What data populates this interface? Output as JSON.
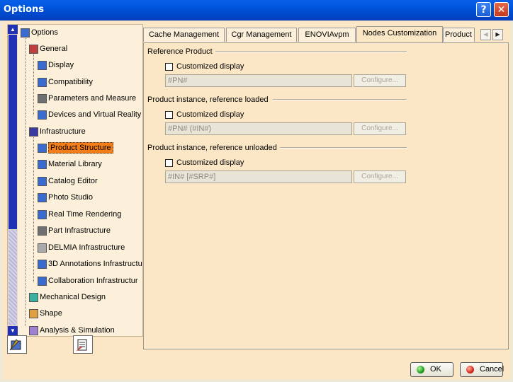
{
  "window": {
    "title": "Options",
    "help_label": "?",
    "close_label": "✕"
  },
  "tree": {
    "items": [
      {
        "label": "Options",
        "icon": "options-tree-icon",
        "color": "#3a6bd1"
      },
      {
        "label": "General",
        "icon": "general-icon",
        "color": "#c04040"
      },
      {
        "label": "Display",
        "icon": "display-icon",
        "color": "#3a6bd1"
      },
      {
        "label": "Compatibility",
        "icon": "compatibility-icon",
        "color": "#3a6bd1"
      },
      {
        "label": "Parameters and Measure",
        "icon": "parameters-icon",
        "color": "#707070"
      },
      {
        "label": "Devices and Virtual Reality",
        "icon": "devices-icon",
        "color": "#3a6bd1"
      },
      {
        "label": "Infrastructure",
        "icon": "infrastructure-icon",
        "color": "#3a3aa0"
      },
      {
        "label": "Product Structure",
        "icon": "product-structure-icon",
        "color": "#3a6bd1"
      },
      {
        "label": "Material Library",
        "icon": "material-library-icon",
        "color": "#3a6bd1"
      },
      {
        "label": "Catalog Editor",
        "icon": "catalog-editor-icon",
        "color": "#3a6bd1"
      },
      {
        "label": "Photo Studio",
        "icon": "photo-studio-icon",
        "color": "#3a6bd1"
      },
      {
        "label": "Real Time Rendering",
        "icon": "rendering-icon",
        "color": "#3a6bd1"
      },
      {
        "label": "Part Infrastructure",
        "icon": "part-infrastructure-icon",
        "color": "#707070"
      },
      {
        "label": "DELMIA Infrastructure",
        "icon": "delmia-icon",
        "color": "#aaaaaa"
      },
      {
        "label": "3D Annotations Infrastructu",
        "icon": "annotations-icon",
        "color": "#3a6bd1"
      },
      {
        "label": "Collaboration Infrastructur",
        "icon": "collaboration-icon",
        "color": "#3a6bd1"
      },
      {
        "label": "Mechanical Design",
        "icon": "mechanical-design-icon",
        "color": "#3ab0a0"
      },
      {
        "label": "Shape",
        "icon": "shape-icon",
        "color": "#e0a040"
      },
      {
        "label": "Analysis & Simulation",
        "icon": "analysis-icon",
        "color": "#a080d0"
      }
    ],
    "selected": "Product Structure"
  },
  "tabs": [
    "Cache Management",
    "Cgr Management",
    "ENOVIAvpm",
    "Nodes Customization",
    "Product"
  ],
  "active_tab": "Nodes Customization",
  "groups": [
    {
      "title": "Reference Product",
      "checkbox_label": "Customized display",
      "field_value": "#PN#",
      "button_label": "Configure..."
    },
    {
      "title": "Product instance, reference loaded",
      "checkbox_label": "Customized display",
      "field_value": "#PN# (#IN#)",
      "button_label": "Configure..."
    },
    {
      "title": "Product instance, reference unloaded",
      "checkbox_label": "Customized display",
      "field_value": "#IN# [#SRP#]",
      "button_label": "Configure..."
    }
  ],
  "footer": {
    "ok_label": "OK",
    "cancel_label": "Cancel"
  },
  "colors": {
    "title_bar": "#0054e3",
    "selection": "#f57e19",
    "panel": "#fbe7c6"
  }
}
